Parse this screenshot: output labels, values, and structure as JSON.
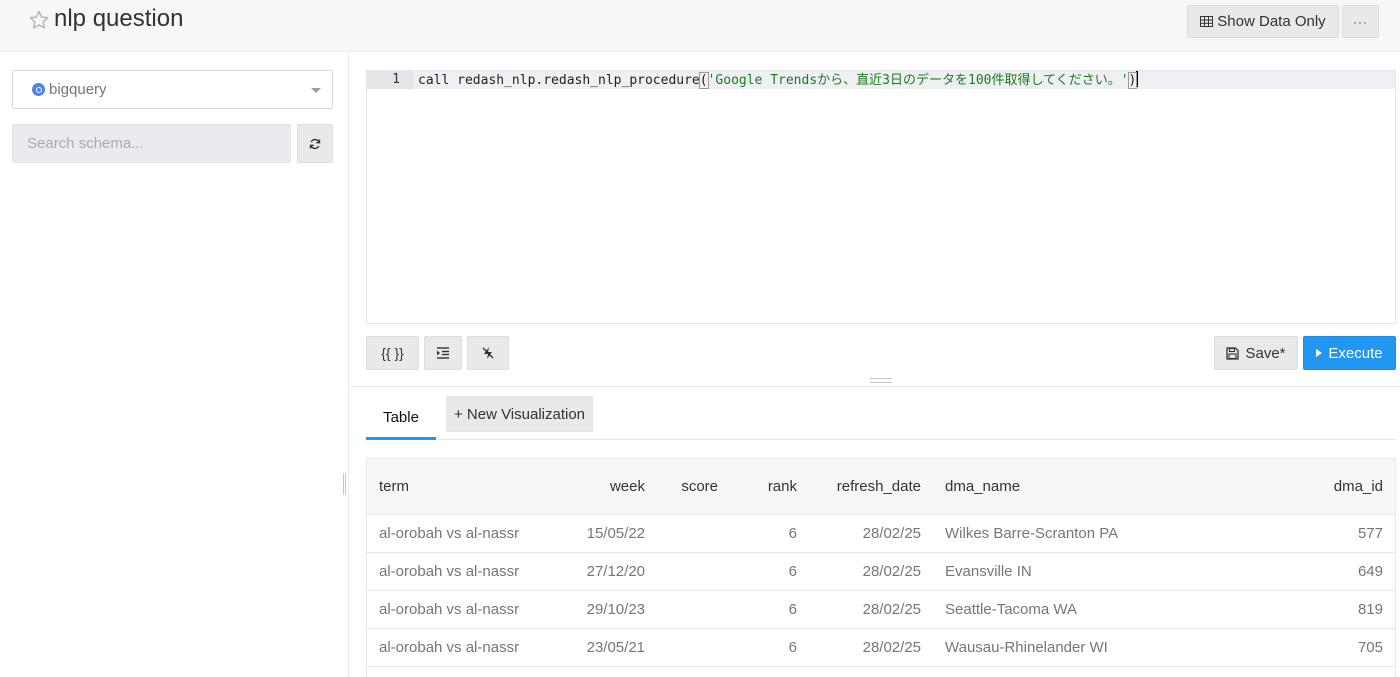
{
  "header": {
    "title": "nlp question",
    "show_data_only": "Show Data Only",
    "more": "···"
  },
  "sidebar": {
    "data_source": "bigquery",
    "schema_search_placeholder": "Search schema..."
  },
  "editor": {
    "line_number": "1",
    "code_prefix": "call redash_nlp.redash_nlp_procedure",
    "code_open": "(",
    "code_string": "'Google Trendsから、直近3日のデータを100件取得してください。'",
    "code_close": ")"
  },
  "toolbar": {
    "braces_label": "{{ }}",
    "save_label": "Save*",
    "execute_label": "Execute"
  },
  "tabs": {
    "table_label": "Table",
    "new_visualization_label": "+ New Visualization"
  },
  "results": {
    "columns": [
      "term",
      "week",
      "score",
      "rank",
      "refresh_date",
      "dma_name",
      "dma_id"
    ],
    "rows": [
      [
        "al-orobah vs al-nassr",
        "15/05/22",
        "",
        "6",
        "28/02/25",
        "Wilkes Barre-Scranton PA",
        "577"
      ],
      [
        "al-orobah vs al-nassr",
        "27/12/20",
        "",
        "6",
        "28/02/25",
        "Evansville IN",
        "649"
      ],
      [
        "al-orobah vs al-nassr",
        "29/10/23",
        "",
        "6",
        "28/02/25",
        "Seattle-Tacoma WA",
        "819"
      ],
      [
        "al-orobah vs al-nassr",
        "23/05/21",
        "",
        "6",
        "28/02/25",
        "Wausau-Rhinelander WI",
        "705"
      ],
      [
        "",
        "",
        "",
        "",
        "",
        "",
        ""
      ]
    ]
  },
  "colors": {
    "accent": "#2196f3",
    "string": "#1a7d1a",
    "bigquery": "#4a84f1"
  }
}
